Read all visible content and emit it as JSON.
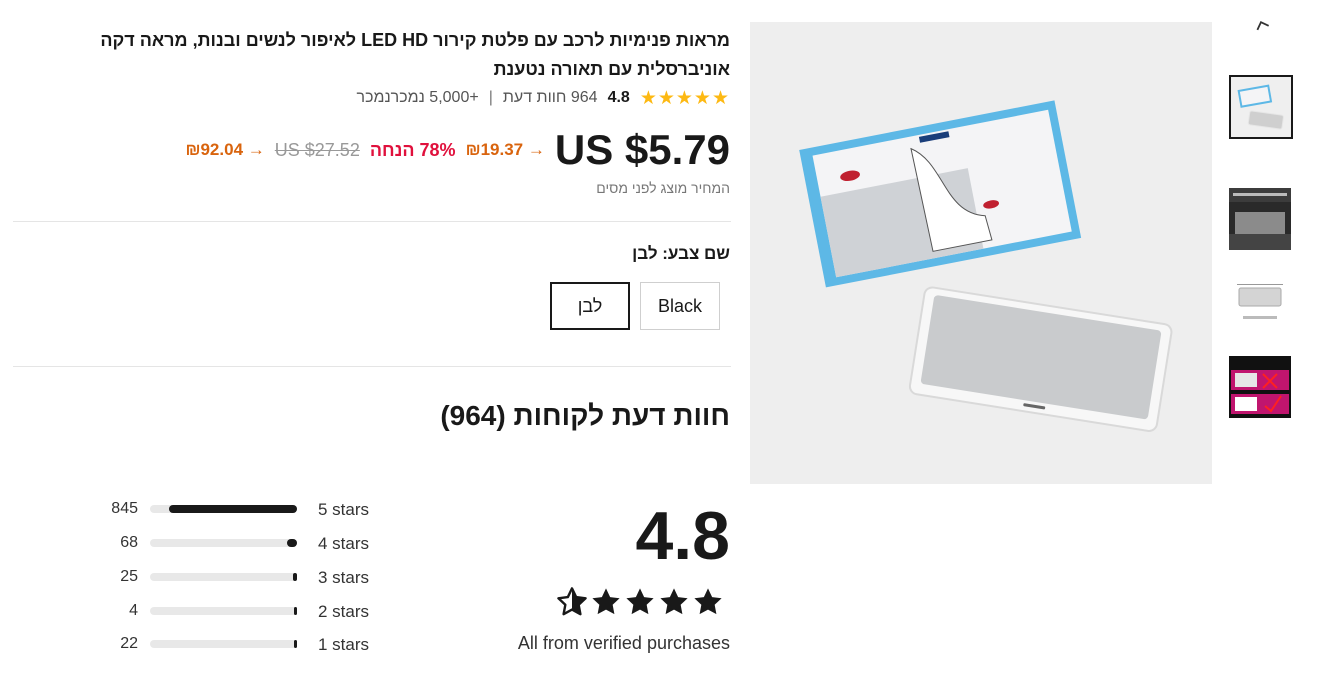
{
  "product": {
    "title": "מראות פנימיות לרכב עם פלטת קירור LED HD לאיפור לנשים ובנות, מראה דקה אוניברסלית עם תאורה נטענת",
    "rating_stars": "★★★★★",
    "rating_value": "4.8",
    "reviews_text": "964 חוות דעת",
    "separator": "|",
    "sold_text": "+5,000 נמכרנמכר"
  },
  "price": {
    "current": "US $5.79",
    "current_converted": "→ ₪19.37",
    "discount": "78% הנחה",
    "original": "US $27.52",
    "original_converted": "→ ₪92.04",
    "tax_note": "המחיר מוצג לפני מסים"
  },
  "color": {
    "label": "שם צבע: לבן",
    "options": [
      {
        "label": "לבן",
        "selected": true
      },
      {
        "label": "Black",
        "selected": false
      }
    ]
  },
  "reviews": {
    "title": "חוות דעת לקוחות (964)",
    "overall": "4.8",
    "verified_note": "All from verified purchases",
    "histogram": [
      {
        "label": "5 stars",
        "count": "845",
        "fraction": 0.874
      },
      {
        "label": "4 stars",
        "count": "68",
        "fraction": 0.07
      },
      {
        "label": "3 stars",
        "count": "25",
        "fraction": 0.026
      },
      {
        "label": "2 stars",
        "count": "4",
        "fraction": 0.004
      },
      {
        "label": "1 stars",
        "count": "22",
        "fraction": 0.023
      }
    ]
  },
  "gallery": {
    "thumbnails": [
      "product-box-thumb",
      "night-vision-thumb",
      "dimensions-thumb",
      "lamp-comparison-thumb"
    ],
    "selected_index": 0
  },
  "colors": {
    "accent_orange": "#d9640e",
    "discount_red": "#e0103c",
    "star_yellow": "#fdb913",
    "text_dark": "#191919"
  }
}
